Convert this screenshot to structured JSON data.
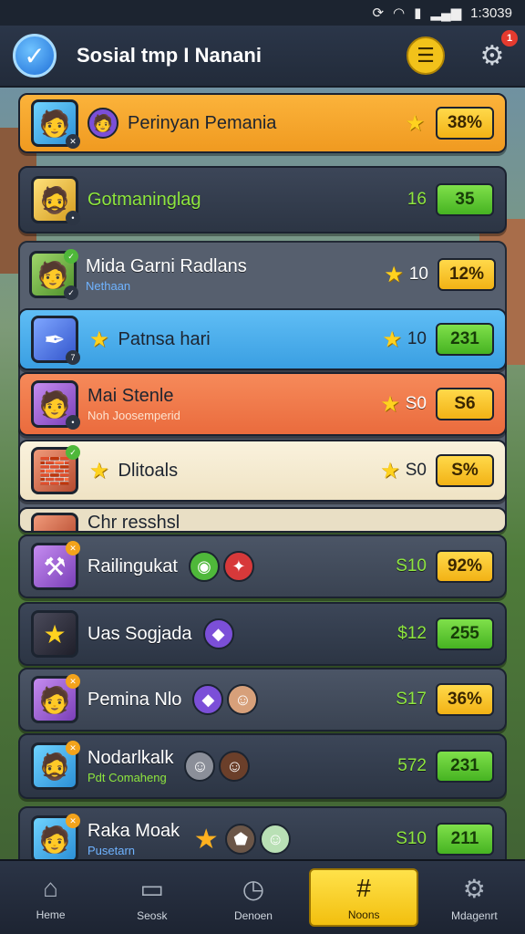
{
  "status_bar": {
    "time": "1:3039"
  },
  "header": {
    "title": "Sosial tmp I Nanani",
    "notification_count": "1"
  },
  "top_rows": [
    {
      "name": "Perinyan Pemania",
      "pill": "38%",
      "style": "orange"
    },
    {
      "name": "Gotmaninglag",
      "num": "16",
      "pill": "35",
      "style": "dark"
    }
  ],
  "group_rows": [
    {
      "name": "Mida Garni Radlans",
      "sub": "Nethaan",
      "num": "10",
      "pill": "12%"
    },
    {
      "name": "Patnsa hari",
      "num": "10",
      "pill": "231"
    },
    {
      "name": "Mai Stenle",
      "sub": "Noh Joosemperid",
      "num": "S0",
      "pill": "S6"
    },
    {
      "name": "Dlitoals",
      "num": "S0",
      "pill": "S%"
    },
    {
      "name": "Chr resshsl"
    }
  ],
  "lower_rows": [
    {
      "name": "Railingukat",
      "num": "S10",
      "pill": "92%"
    },
    {
      "name": "Uas Sogjada",
      "num": "$12",
      "pill": "255"
    },
    {
      "name": "Pemina Nlo",
      "num": "S17",
      "pill": "36%"
    },
    {
      "name": "Nodarlkalk",
      "sub": "Pdt Comaheng",
      "num": "572",
      "pill": "231"
    },
    {
      "name": "Raka Moak",
      "sub": "Pusetarn",
      "num": "S10",
      "pill": "211"
    }
  ],
  "nav": [
    {
      "label": "Heme",
      "icon": "home-icon"
    },
    {
      "label": "Seosk",
      "icon": "window-icon"
    },
    {
      "label": "Denoen",
      "icon": "clock-icon"
    },
    {
      "label": "Noons",
      "icon": "grid-icon"
    },
    {
      "label": "Mdagenrt",
      "icon": "gear-icon"
    }
  ]
}
